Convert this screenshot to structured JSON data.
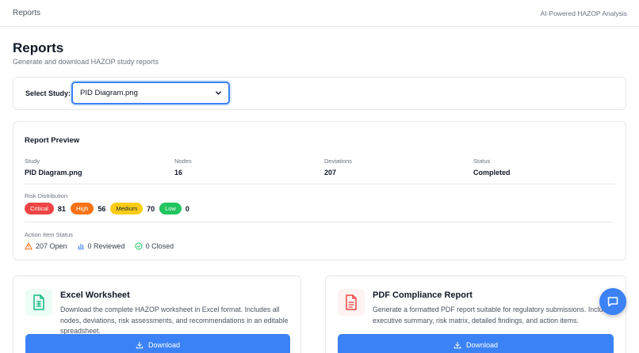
{
  "topbar": {
    "breadcrumb": "Reports",
    "app_name": "AI-Powered HAZOP Analysis"
  },
  "page": {
    "title": "Reports",
    "subtitle": "Generate and download HAZOP study reports"
  },
  "study_select": {
    "label": "Select Study:",
    "selected": "PID Diagram.png"
  },
  "preview": {
    "heading": "Report Preview",
    "study_label": "Study",
    "study_value": "PID Diagram.png",
    "nodes_label": "Nodes",
    "nodes_value": "16",
    "deviations_label": "Deviations",
    "deviations_value": "207",
    "status_label": "Status",
    "status_value": "Completed",
    "risk_label": "Risk Distribution",
    "risks": [
      {
        "label": "Critical",
        "count": "81",
        "color": "#ef4444"
      },
      {
        "label": "High",
        "count": "56",
        "color": "#f97316"
      },
      {
        "label": "Medium",
        "count": "70",
        "color": "#facc15"
      },
      {
        "label": "Low",
        "count": "0",
        "color": "#22c55e"
      }
    ],
    "action_label": "Action Item Status",
    "actions": {
      "open": "207 Open",
      "reviewed": "0 Reviewed",
      "closed": "0 Closed"
    }
  },
  "excel": {
    "title": "Excel Worksheet",
    "description": "Download the complete HAZOP worksheet in Excel format. Includes all nodes, deviations, risk assessments, and recommendations in an editable spreadsheet.",
    "button": "Download"
  },
  "pdf": {
    "title": "PDF Compliance Report",
    "description": "Generate a formatted PDF report suitable for regulatory submissions. Includes executive summary, risk matrix, detailed findings, and action items.",
    "button": "Download"
  },
  "colors": {
    "accent": "#3b82f6"
  },
  "icons": [
    "chevron-down-icon",
    "warning-triangle-icon",
    "bar-chart-icon",
    "check-circle-icon",
    "spreadsheet-icon",
    "document-icon",
    "download-icon",
    "chat-icon"
  ]
}
